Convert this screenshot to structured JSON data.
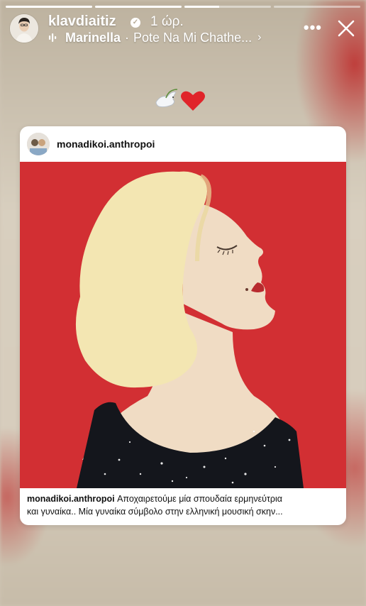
{
  "story": {
    "progress": [
      1,
      1,
      0.4,
      0
    ],
    "username": "klavdiaitiz",
    "verified_icon": "verified-badge-icon",
    "time": "1 ώρ.",
    "music": {
      "artist": "Marinella",
      "separator": "·",
      "song": "Pote Na Mi Chathe...",
      "chevron": "›"
    },
    "more": "•••",
    "emojis": "🕊️❤️"
  },
  "card": {
    "username": "monadikoi.anthropoi",
    "caption_user": "monadikoi.anthropoi",
    "caption_line1": " Αποχαιρετούμε μία σπουδαία ερμηνεύτρια",
    "caption_line2": "και γυναίκα.. Μία γυναίκα σύμβολο στην ελληνική μουσική σκην..."
  },
  "colors": {
    "poster_red": "#d22f33",
    "hair": "#f3e6b2",
    "skin": "#f0dcc4",
    "dress": "#14161c"
  }
}
